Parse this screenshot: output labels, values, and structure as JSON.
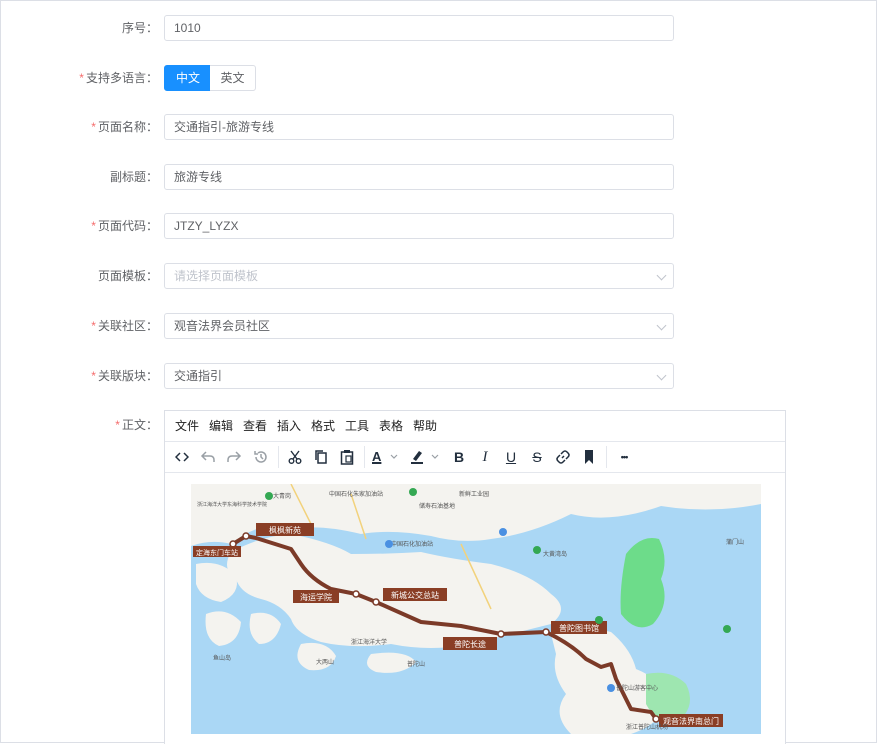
{
  "form": {
    "seq": {
      "label": "序号",
      "value": "1010"
    },
    "multilang": {
      "label": "支持多语言",
      "options": [
        "中文",
        "英文"
      ],
      "selected": "中文"
    },
    "page_name": {
      "label": "页面名称",
      "value": "交通指引-旅游专线"
    },
    "subtitle": {
      "label": "副标题",
      "value": "旅游专线"
    },
    "page_code": {
      "label": "页面代码",
      "value": "JTZY_LYZX"
    },
    "template": {
      "label": "页面模板",
      "placeholder": "请选择页面模板"
    },
    "community": {
      "label": "关联社区",
      "value": "观音法界会员社区"
    },
    "section": {
      "label": "关联版块",
      "value": "交通指引"
    },
    "body": {
      "label": "正文"
    }
  },
  "editor": {
    "menu": [
      "文件",
      "编辑",
      "查看",
      "插入",
      "格式",
      "工具",
      "表格",
      "帮助"
    ],
    "toolbar_icons": [
      "code-icon",
      "undo-icon",
      "redo-icon",
      "history-icon",
      "cut-icon",
      "copy-icon",
      "paste-icon",
      "text-color-icon",
      "highlight-color-icon",
      "bold-icon",
      "italic-icon",
      "underline-icon",
      "strikethrough-icon",
      "link-icon",
      "bookmark-icon",
      "more-icon"
    ],
    "toolbar_glyphs": {
      "bold": "B",
      "italic": "I",
      "underline": "U",
      "strike": "S",
      "text_color": "A",
      "more": "•••"
    },
    "map_labels": [
      "枫枫新苑",
      "定海东门车站",
      "海运学院",
      "新城公交总站",
      "普陀长途",
      "普陀图书馆",
      "观音法界南总门"
    ],
    "map_small_labels": [
      "大青岗",
      "中国石化朱家加油站",
      "储寿石油基地",
      "新鲜工业园",
      "浙江海洋大学东海科学技术学院",
      "中国石化加油站",
      "大黄湾岛",
      "鱼山岛",
      "普陀山",
      "蒲门山",
      "大两山",
      "浙江海洋大学",
      "普陀山游客中心",
      "浙江普陀山机场"
    ]
  },
  "colors": {
    "accent": "#1890ff",
    "required": "#f56c6c",
    "route": "#7b3a28",
    "label_bg": "#8a3e25",
    "sea": "#aad7f5",
    "land": "#f4f3ef",
    "green": "#6ddc8a"
  }
}
